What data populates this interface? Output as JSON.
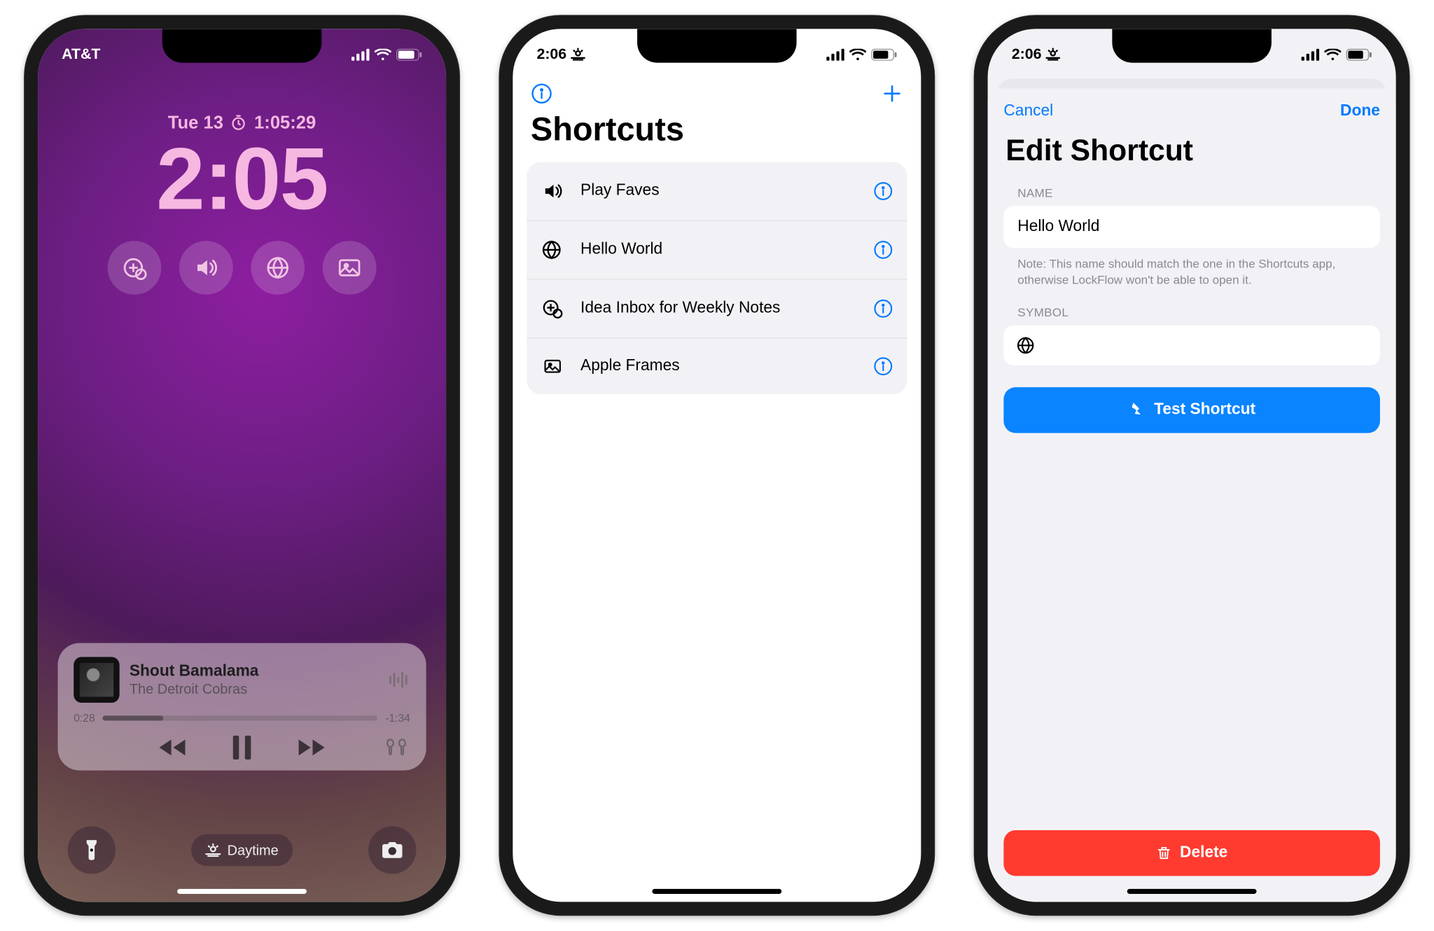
{
  "phone1": {
    "status": {
      "carrier": "AT&T"
    },
    "date": "Tue 13",
    "timer": "1:05:29",
    "time": "2:05",
    "widget_icons": [
      "doc-plus-icon",
      "speaker-wave-icon",
      "globe-icon",
      "photo-icon"
    ],
    "music": {
      "title": "Shout Bamalama",
      "artist": "The Detroit Cobras",
      "elapsed": "0:28",
      "remaining": "-1:34"
    },
    "focus_label": "Daytime"
  },
  "phone2": {
    "status_time": "2:06",
    "title": "Shortcuts",
    "rows": [
      {
        "icon": "speaker-wave-icon",
        "label": "Play Faves"
      },
      {
        "icon": "globe-icon",
        "label": "Hello World"
      },
      {
        "icon": "doc-plus-icon",
        "label": "Idea Inbox for Weekly Notes"
      },
      {
        "icon": "photo-icon",
        "label": "Apple Frames"
      }
    ]
  },
  "phone3": {
    "status_time": "2:06",
    "cancel": "Cancel",
    "done": "Done",
    "title": "Edit Shortcut",
    "name_section": "NAME",
    "name_value": "Hello World",
    "note": "Note: This name should match the one in the Shortcuts app, otherwise LockFlow won't be able to open it.",
    "symbol_section": "SYMBOL",
    "symbol_icon": "globe-icon",
    "test_label": "Test Shortcut",
    "delete_label": "Delete"
  }
}
